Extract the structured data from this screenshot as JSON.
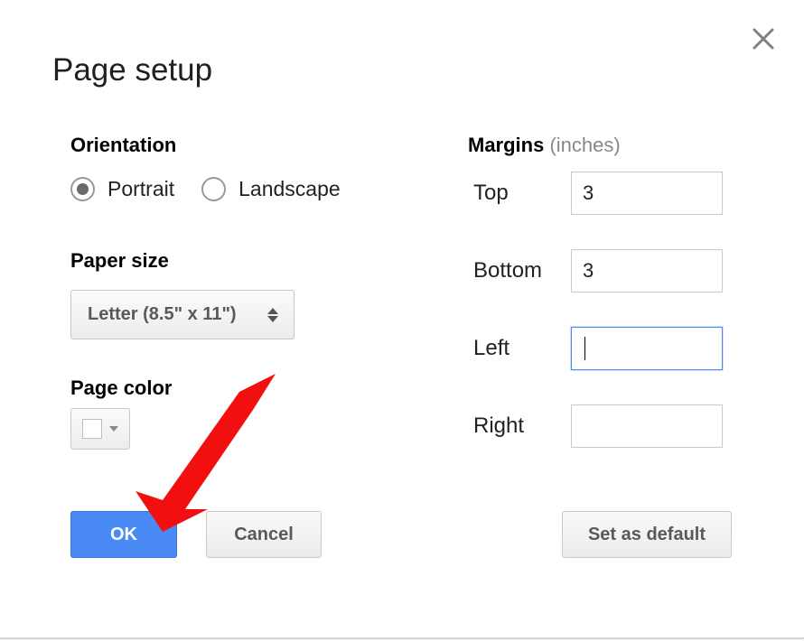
{
  "dialog": {
    "title": "Page setup"
  },
  "orientation": {
    "label": "Orientation",
    "options": {
      "portrait": "Portrait",
      "landscape": "Landscape"
    },
    "selected": "portrait"
  },
  "paper_size": {
    "label": "Paper size",
    "value": "Letter (8.5\" x 11\")"
  },
  "page_color": {
    "label": "Page color",
    "value": "#ffffff"
  },
  "margins": {
    "label": "Margins",
    "unit_suffix": " (inches)",
    "rows": {
      "top": {
        "label": "Top",
        "value": "3"
      },
      "bottom": {
        "label": "Bottom",
        "value": "3"
      },
      "left": {
        "label": "Left",
        "value": ""
      },
      "right": {
        "label": "Right",
        "value": ""
      }
    },
    "focused": "left"
  },
  "buttons": {
    "ok": "OK",
    "cancel": "Cancel",
    "set_default": "Set as default"
  }
}
